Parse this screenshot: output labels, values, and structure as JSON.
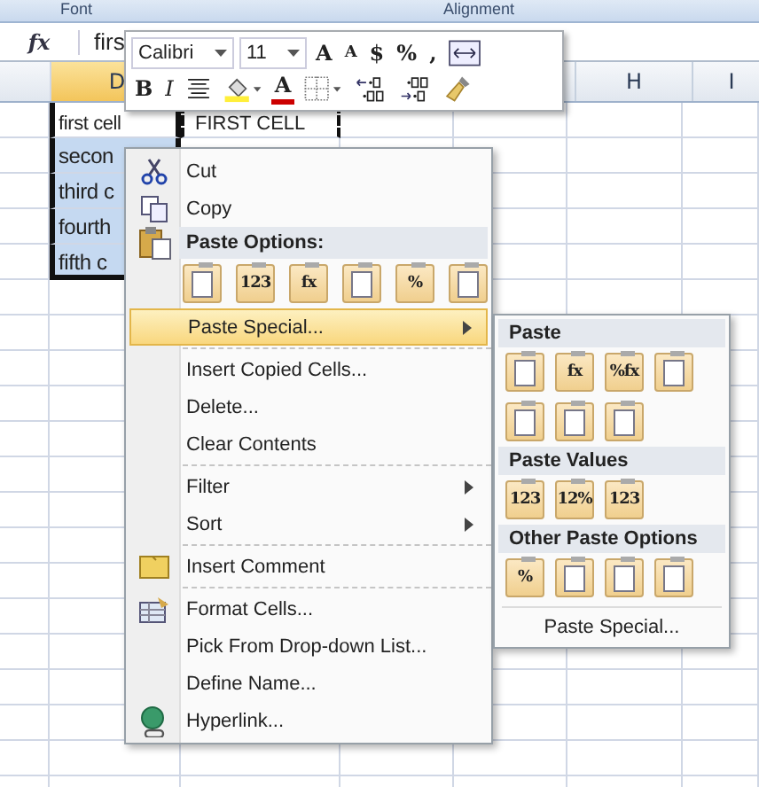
{
  "ribbon_groups": [
    "Font",
    "Alignment"
  ],
  "formula_bar": {
    "fx": "fx",
    "value": "firs"
  },
  "columns": [
    {
      "label": "D",
      "selected": true
    },
    {
      "label": "H",
      "selected": false
    },
    {
      "label": "I",
      "selected": false
    }
  ],
  "cells": [
    {
      "text": "first cell",
      "selected": false
    },
    {
      "text": "secon",
      "selected": true
    },
    {
      "text": "third c",
      "selected": true
    },
    {
      "text": "fourth",
      "selected": true
    },
    {
      "text": "fifth c",
      "selected": true
    }
  ],
  "copied_cell": "FIRST CELL",
  "mini_toolbar": {
    "font": "Calibri",
    "size": "11",
    "row1": [
      {
        "kind": "glyph",
        "label": "A"
      },
      {
        "kind": "glyph",
        "label": "A"
      },
      {
        "kind": "glyph",
        "label": "$"
      },
      {
        "kind": "glyph",
        "label": "%"
      },
      {
        "kind": "glyph",
        "label": ","
      },
      {
        "kind": "icon"
      }
    ],
    "row2": [
      {
        "kind": "glyph",
        "label": "B"
      },
      {
        "kind": "glyph",
        "label": "I"
      },
      {
        "kind": "icon"
      },
      {
        "kind": "icon"
      },
      {
        "kind": "glyph",
        "label": "A"
      },
      {
        "kind": "icon"
      },
      {
        "kind": "icon"
      },
      {
        "kind": "icon"
      },
      {
        "kind": "icon"
      }
    ]
  },
  "context_menu": [
    {
      "kind": "item",
      "label": "Cut",
      "has_submenu": false,
      "selected": false
    },
    {
      "kind": "item",
      "label": "Copy",
      "has_submenu": false,
      "selected": false
    },
    {
      "kind": "header",
      "label": "Paste Options:"
    },
    {
      "kind": "paste_row",
      "buttons": [
        {
          "kind": "icon"
        },
        {
          "kind": "text",
          "label": "123"
        },
        {
          "kind": "text",
          "label": "fx"
        },
        {
          "kind": "icon"
        },
        {
          "kind": "text",
          "label": "%"
        },
        {
          "kind": "icon"
        }
      ]
    },
    {
      "kind": "item",
      "label": "Paste Special...",
      "has_submenu": true,
      "selected": true
    },
    {
      "kind": "separator"
    },
    {
      "kind": "item",
      "label": "Insert Copied Cells...",
      "has_submenu": false,
      "selected": false
    },
    {
      "kind": "item",
      "label": "Delete...",
      "has_submenu": false,
      "selected": false
    },
    {
      "kind": "item",
      "label": "Clear Contents",
      "has_submenu": false,
      "selected": false
    },
    {
      "kind": "separator"
    },
    {
      "kind": "item",
      "label": "Filter",
      "has_submenu": true,
      "selected": false
    },
    {
      "kind": "item",
      "label": "Sort",
      "has_submenu": true,
      "selected": false
    },
    {
      "kind": "separator"
    },
    {
      "kind": "item",
      "label": "Insert Comment",
      "has_submenu": false,
      "selected": false
    },
    {
      "kind": "separator"
    },
    {
      "kind": "item",
      "label": "Format Cells...",
      "has_submenu": false,
      "selected": false
    },
    {
      "kind": "item",
      "label": "Pick From Drop-down List...",
      "has_submenu": false,
      "selected": false
    },
    {
      "kind": "item",
      "label": "Define Name...",
      "has_submenu": false,
      "selected": false
    },
    {
      "kind": "item",
      "label": "Hyperlink...",
      "has_submenu": false,
      "selected": false
    }
  ],
  "submenu": [
    {
      "kind": "header",
      "label": "Paste"
    },
    {
      "kind": "paste_row",
      "buttons": [
        {
          "kind": "icon"
        },
        {
          "kind": "text",
          "label": "fx"
        },
        {
          "kind": "text",
          "label": "%fx"
        },
        {
          "kind": "icon"
        }
      ]
    },
    {
      "kind": "paste_row",
      "buttons": [
        {
          "kind": "icon"
        },
        {
          "kind": "icon"
        },
        {
          "kind": "icon"
        }
      ]
    },
    {
      "kind": "header",
      "label": "Paste Values"
    },
    {
      "kind": "paste_row",
      "buttons": [
        {
          "kind": "text",
          "label": "123"
        },
        {
          "kind": "text",
          "label": "12%"
        },
        {
          "kind": "text",
          "label": "123"
        }
      ]
    },
    {
      "kind": "header",
      "label": "Other Paste Options"
    },
    {
      "kind": "paste_row",
      "buttons": [
        {
          "kind": "text",
          "label": "%"
        },
        {
          "kind": "icon"
        },
        {
          "kind": "icon"
        },
        {
          "kind": "icon"
        }
      ]
    },
    {
      "kind": "separator"
    },
    {
      "kind": "item",
      "label": "Paste Special...",
      "selected": false
    }
  ]
}
